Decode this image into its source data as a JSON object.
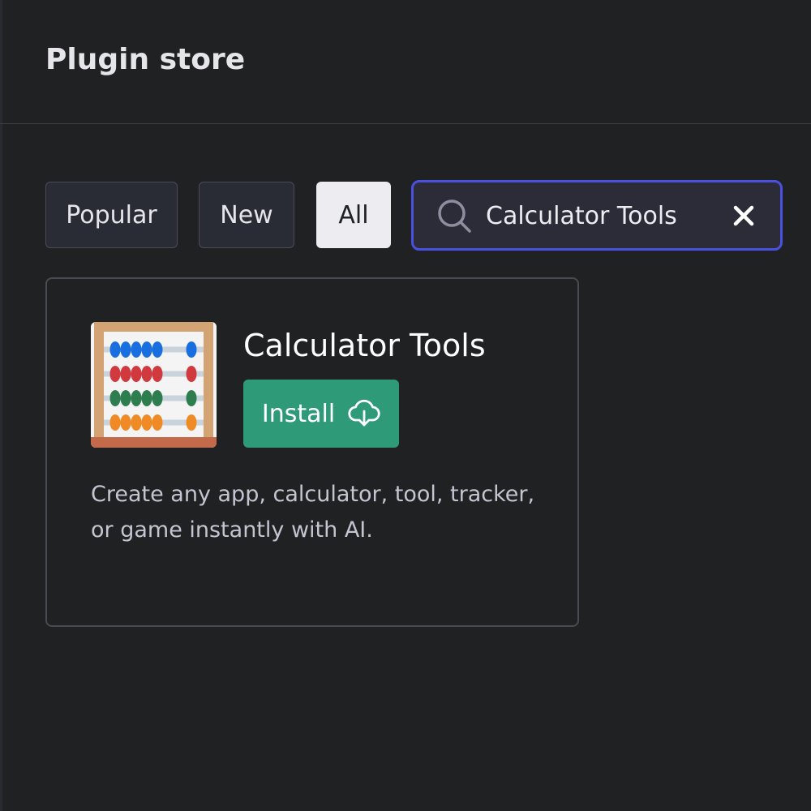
{
  "header": {
    "title": "Plugin store"
  },
  "filters": {
    "popular_label": "Popular",
    "new_label": "New",
    "all_label": "All",
    "selected": "All"
  },
  "search": {
    "value": "Calculator Tools",
    "placeholder": "",
    "icon": "search-icon",
    "clear_icon": "close-icon",
    "focus_color": "#4a50e0"
  },
  "results": [
    {
      "name": "Calculator Tools",
      "install_label": "Install",
      "install_icon": "cloud-download-icon",
      "install_color": "#2f9a78",
      "description": "Create any app, calculator, tool, tracker, or game instantly with AI.",
      "logo": "abacus-logo"
    }
  ],
  "colors": {
    "background": "#202123",
    "selected_filter_bg": "#ececf1"
  }
}
